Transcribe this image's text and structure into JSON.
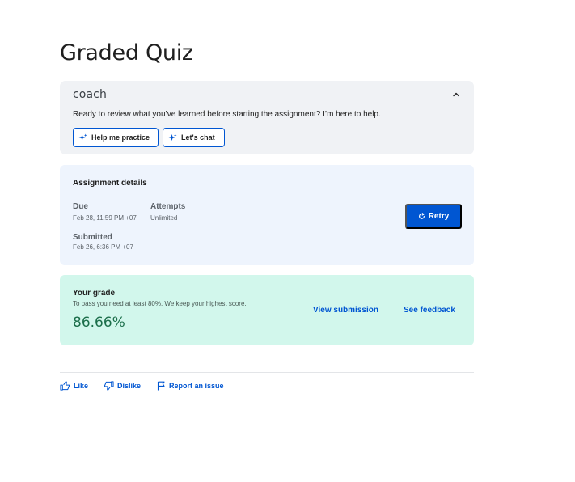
{
  "page": {
    "title": "Graded Quiz"
  },
  "coach": {
    "logo_text": "coach",
    "message": "Ready to review what you’ve learned before starting the assignment? I’m here to help.",
    "buttons": [
      {
        "label": "Help me practice",
        "icon": "sparkle-icon"
      },
      {
        "label": "Let's chat",
        "icon": "sparkle-icon"
      }
    ],
    "collapse_icon": "chevron-up-icon"
  },
  "assignment": {
    "title": "Assignment details",
    "due_label": "Due",
    "due_value": "Feb 28, 11:59 PM +07",
    "attempts_label": "Attempts",
    "attempts_value": "Unlimited",
    "submitted_label": "Submitted",
    "submitted_value": "Feb 26, 6:36 PM +07",
    "retry_label": "Retry",
    "retry_icon": "refresh-icon"
  },
  "grade": {
    "title": "Your grade",
    "note": "To pass you need at least 80%. We keep your highest score.",
    "score": "86.66%",
    "view_submission": "View submission",
    "see_feedback": "See feedback"
  },
  "feedback": {
    "like": "Like",
    "dislike": "Dislike",
    "report": "Report an issue"
  },
  "colors": {
    "accent": "#0056d2",
    "grade_bg": "#d2f7ec",
    "grade_score": "#1b6e4a",
    "assignment_bg": "#eef4fd",
    "coach_bg": "#f0f2f5"
  }
}
